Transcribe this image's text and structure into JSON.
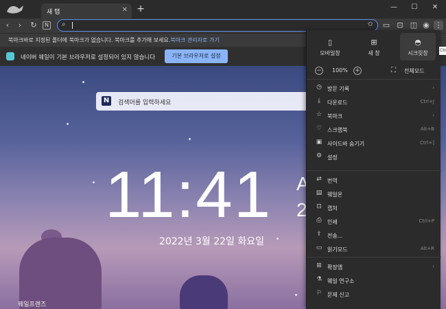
{
  "window": {
    "tab_title": "새 탭",
    "new_tab_symbol": "+",
    "controls": {
      "minimize": "—",
      "maximize": "☐",
      "close": "✕"
    }
  },
  "toolbar": {
    "back": "‹",
    "forward": "›",
    "reload": "↻",
    "naver": "N",
    "address_value": "",
    "address_search_icon": "search-icon",
    "menu_symbol": "⋮"
  },
  "bookmark_bar": {
    "text": "북마크바로 지정된 폴더에 북마크가 없습니다. 북마크를 추가해 보세요.",
    "link": "북마크 관리자로 가기"
  },
  "default_browser_bar": {
    "message": "네이버 웨일이 기본 브라우저로 설정되어 있지 않습니다",
    "button": "기본 브라우저로 설정"
  },
  "new_tab_page": {
    "search_placeholder": "검색어를 입력하세요",
    "search_logo": "N",
    "time": "11:41",
    "ampm_partial": "A",
    "extra_partial": "2",
    "date": "2022년 3월 22일 화요일",
    "caption": "웨일프렌즈"
  },
  "menu": {
    "quick": [
      {
        "label": "모바일창",
        "icon": "▯"
      },
      {
        "label": "새 창",
        "icon": "⊞"
      },
      {
        "label": "시크릿창",
        "icon": "◓"
      }
    ],
    "tooltip": "Ctrl",
    "zoom": {
      "minus": "−",
      "value": "100%",
      "plus": "+",
      "fullscreen": "전체모드"
    },
    "groups": [
      [
        {
          "label": "방문 기록",
          "icon": "◷",
          "right": "›"
        },
        {
          "label": "다운로드",
          "icon": "⤓",
          "right": "Ctrl+J"
        },
        {
          "label": "북마크",
          "icon": "☆",
          "right": "›"
        },
        {
          "label": "스크랩북",
          "icon": "♡",
          "right": "Alt+B"
        },
        {
          "label": "사이드바 숨기기",
          "icon": "▣",
          "right": "Ctrl+]"
        },
        {
          "label": "설정",
          "icon": "⚙",
          "right": ""
        }
      ],
      [
        {
          "label": "번역",
          "icon": "⇄",
          "right": ""
        },
        {
          "label": "웨일온",
          "icon": "▤",
          "right": ""
        },
        {
          "label": "캡처",
          "icon": "⊡",
          "right": ""
        },
        {
          "label": "인쇄",
          "icon": "⎙",
          "right": "Ctrl+P"
        },
        {
          "label": "전송...",
          "icon": "⇪",
          "right": ""
        },
        {
          "label": "읽기모드",
          "icon": "▭",
          "right": "Alt+R"
        }
      ],
      [
        {
          "label": "확장앱",
          "icon": "⊞",
          "right": "›"
        },
        {
          "label": "웨일 연구소",
          "icon": "⚗",
          "right": ""
        },
        {
          "label": "문제 신고",
          "icon": "⚐",
          "right": ""
        }
      ]
    ]
  },
  "colors": {
    "accent": "#8ab4f8",
    "address_border": "#5b8def",
    "menu_bg": "#2b2b2b"
  }
}
